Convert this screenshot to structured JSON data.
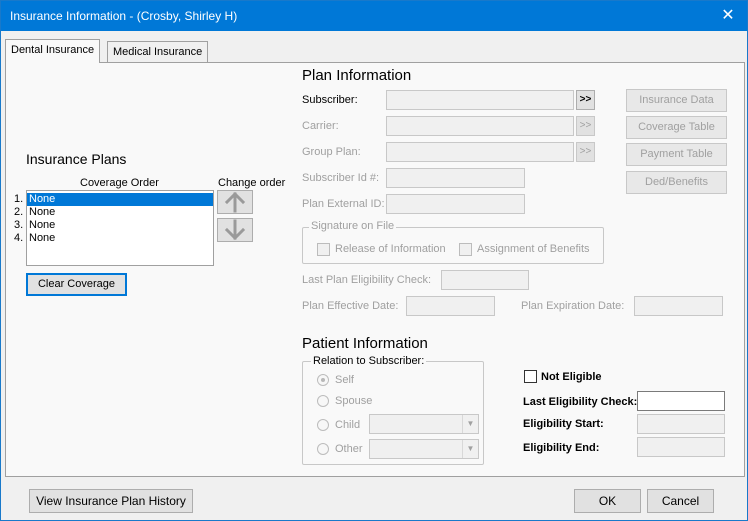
{
  "window": {
    "title": "Insurance Information - (Crosby, Shirley H)",
    "close_glyph": "✕"
  },
  "tabs": [
    {
      "label": "Dental Insurance",
      "active": true
    },
    {
      "label": "Medical Insurance",
      "active": false
    }
  ],
  "insurance_plans": {
    "heading": "Insurance Plans",
    "coverage_order_label": "Coverage Order",
    "change_order_label": "Change order",
    "items": [
      {
        "num": "1.",
        "value": "None",
        "selected": true
      },
      {
        "num": "2.",
        "value": "None",
        "selected": false
      },
      {
        "num": "3.",
        "value": "None",
        "selected": false
      },
      {
        "num": "4.",
        "value": "None",
        "selected": false
      }
    ],
    "clear_coverage_label": "Clear Coverage"
  },
  "plan_information": {
    "heading": "Plan Information",
    "subscriber_label": "Subscriber:",
    "subscriber_value": "",
    "carrier_label": "Carrier:",
    "carrier_value": "",
    "group_plan_label": "Group Plan:",
    "group_plan_value": "",
    "subscriber_id_label": "Subscriber Id #:",
    "subscriber_id_value": "",
    "plan_external_id_label": "Plan External ID:",
    "plan_external_id_value": "",
    "more_glyph": ">>",
    "signature_on_file": {
      "title": "Signature on File",
      "release_label": "Release of Information",
      "assignment_label": "Assignment of Benefits"
    },
    "last_plan_eligibility_label": "Last Plan Eligibility Check:",
    "plan_effective_date_label": "Plan Effective Date:",
    "plan_expiration_date_label": "Plan Expiration Date:"
  },
  "side_buttons": {
    "insurance_data": "Insurance Data",
    "coverage_table": "Coverage Table",
    "payment_table": "Payment Table",
    "ded_benefits": "Ded/Benefits"
  },
  "patient_information": {
    "heading": "Patient Information",
    "relation_title": "Relation to Subscriber:",
    "self_label": "Self",
    "spouse_label": "Spouse",
    "child_label": "Child",
    "other_label": "Other",
    "not_eligible_label": "Not Eligible",
    "last_eligibility_check_label": "Last Eligibility Check:",
    "eligibility_start_label": "Eligibility Start:",
    "eligibility_end_label": "Eligibility End:"
  },
  "footer": {
    "view_history_label": "View Insurance Plan History",
    "ok_label": "OK",
    "cancel_label": "Cancel"
  },
  "colors": {
    "titlebar": "#0078d7",
    "selection": "#0078d7"
  }
}
